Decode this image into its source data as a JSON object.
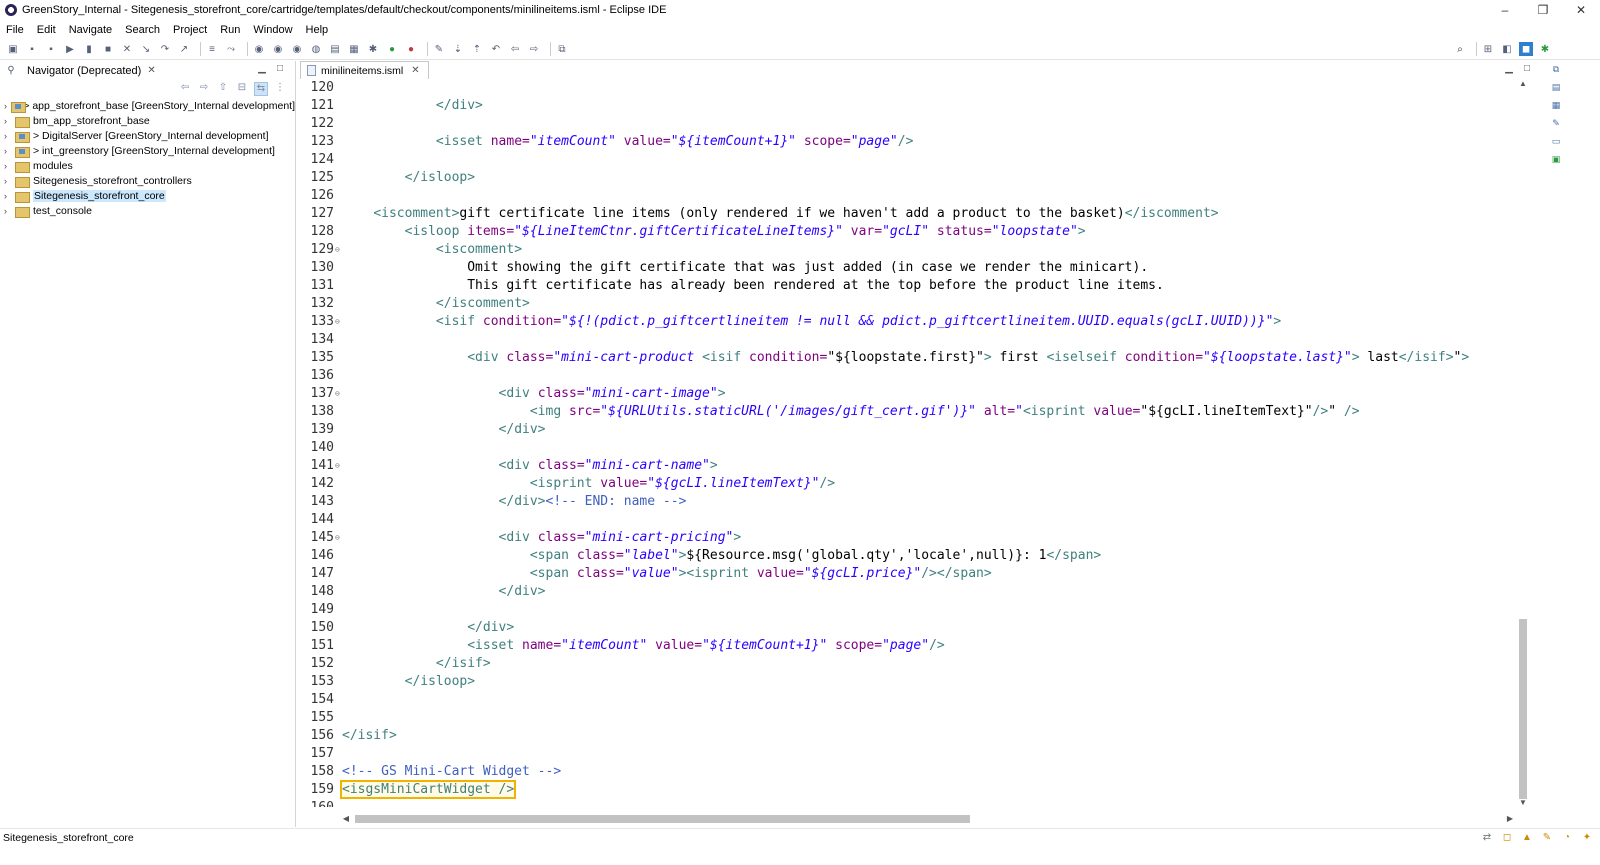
{
  "window": {
    "title": "GreenStory_Internal - Sitegenesis_storefront_core/cartridge/templates/default/checkout/components/minilineitems.isml - Eclipse IDE",
    "minimize": "–",
    "restore": "❐",
    "close": "✕"
  },
  "menu": [
    "File",
    "Edit",
    "Navigate",
    "Search",
    "Project",
    "Run",
    "Window",
    "Help"
  ],
  "navigator": {
    "tab_label": "Navigator (Deprecated)",
    "close": "✕",
    "items": [
      {
        "label": "> app_storefront_base [GreenStory_Internal development]",
        "project": true,
        "selected": false
      },
      {
        "label": "bm_app_storefront_base",
        "project": false,
        "selected": false
      },
      {
        "label": "> DigitalServer [GreenStory_Internal development]",
        "project": true,
        "selected": false
      },
      {
        "label": "> int_greenstory [GreenStory_Internal development]",
        "project": true,
        "selected": false
      },
      {
        "label": "modules",
        "project": false,
        "selected": false
      },
      {
        "label": "Sitegenesis_storefront_controllers",
        "project": false,
        "selected": false
      },
      {
        "label": "Sitegenesis_storefront_core",
        "project": false,
        "selected": true
      },
      {
        "label": "test_console",
        "project": false,
        "selected": false
      }
    ]
  },
  "editor": {
    "tab_label": "minilineitems.isml",
    "close": "✕",
    "lines": [
      {
        "n": "120",
        "html": ""
      },
      {
        "n": "121",
        "html": "            <span class=\"t\">&lt;/div&gt;</span>"
      },
      {
        "n": "122",
        "html": ""
      },
      {
        "n": "123",
        "html": "            <span class=\"t\">&lt;isset</span> <span class=\"a\">name=</span><span class=\"v\">\"itemCount\"</span> <span class=\"a\">value=</span><span class=\"v\">\"${itemCount+1}\"</span> <span class=\"a\">scope=</span><span class=\"v\">\"page\"</span><span class=\"t\">/&gt;</span>"
      },
      {
        "n": "124",
        "html": ""
      },
      {
        "n": "125",
        "html": "        <span class=\"t\">&lt;/isloop&gt;</span>"
      },
      {
        "n": "126",
        "html": ""
      },
      {
        "n": "127",
        "html": "    <span class=\"t\">&lt;iscomment&gt;</span>gift certificate line items (only rendered if we haven't add a product to the basket)<span class=\"t\">&lt;/iscomment&gt;</span>"
      },
      {
        "n": "128",
        "html": "        <span class=\"t\">&lt;isloop</span> <span class=\"a\">items=</span><span class=\"v\">\"${LineItemCtnr.giftCertificateLineItems}\"</span> <span class=\"a\">var=</span><span class=\"v\">\"gcLI\"</span> <span class=\"a\">status=</span><span class=\"v\">\"loopstate\"</span><span class=\"t\">&gt;</span>"
      },
      {
        "n": "129",
        "fold": true,
        "html": "            <span class=\"t\">&lt;iscomment&gt;</span>"
      },
      {
        "n": "130",
        "html": "                Omit showing the gift certificate that was just added (in case we render the minicart)."
      },
      {
        "n": "131",
        "html": "                This gift certificate has already been rendered at the top before the product line items."
      },
      {
        "n": "132",
        "html": "            <span class=\"t\">&lt;/iscomment&gt;</span>"
      },
      {
        "n": "133",
        "fold": true,
        "html": "            <span class=\"t\">&lt;isif</span> <span class=\"a\">condition=</span><span class=\"v\">\"${!(pdict.p_giftcertlineitem != null &amp;&amp; pdict.p_giftcertlineitem.UUID.equals(gcLI.UUID))}\"</span><span class=\"t\">&gt;</span>"
      },
      {
        "n": "134",
        "html": ""
      },
      {
        "n": "135",
        "html": "                <span class=\"t\">&lt;div</span> <span class=\"a\">class=</span><span class=\"v\">\"mini-cart-product </span><span class=\"t\">&lt;isif</span> <span class=\"a\">condition=</span>\"${loopstate.first}\"<span class=\"t\">&gt;</span> first <span class=\"t\">&lt;iselseif</span> <span class=\"a\">condition=</span><span class=\"v\">\"${loopstate.last}\"</span><span class=\"t\">&gt;</span> last<span class=\"t\">&lt;/isif&gt;</span>\"<span class=\"t\">&gt;</span>"
      },
      {
        "n": "136",
        "html": ""
      },
      {
        "n": "137",
        "fold": true,
        "html": "                    <span class=\"t\">&lt;div</span> <span class=\"a\">class=</span><span class=\"v\">\"mini-cart-image\"</span><span class=\"t\">&gt;</span>"
      },
      {
        "n": "138",
        "html": "                        <span class=\"t\">&lt;img</span> <span class=\"a\">src=</span><span class=\"v\">\"${URLUtils.staticURL('/images/gift_cert.gif')}\"</span> <span class=\"a\">alt=</span><span class=\"v\">\"</span><span class=\"t\">&lt;isprint</span> <span class=\"a\">value=</span>\"${gcLI.lineItemText}\"<span class=\"t\">/&gt;</span>\" <span class=\"t\">/&gt;</span>"
      },
      {
        "n": "139",
        "html": "                    <span class=\"t\">&lt;/div&gt;</span>"
      },
      {
        "n": "140",
        "html": ""
      },
      {
        "n": "141",
        "fold": true,
        "html": "                    <span class=\"t\">&lt;div</span> <span class=\"a\">class=</span><span class=\"v\">\"mini-cart-name\"</span><span class=\"t\">&gt;</span>"
      },
      {
        "n": "142",
        "html": "                        <span class=\"t\">&lt;isprint</span> <span class=\"a\">value=</span><span class=\"v\">\"${gcLI.lineItemText}\"</span><span class=\"t\">/&gt;</span>"
      },
      {
        "n": "143",
        "html": "                    <span class=\"t\">&lt;/div&gt;</span><span class=\"c\">&lt;!-- END: name --&gt;</span>"
      },
      {
        "n": "144",
        "html": ""
      },
      {
        "n": "145",
        "fold": true,
        "html": "                    <span class=\"t\">&lt;div</span> <span class=\"a\">class=</span><span class=\"v\">\"mini-cart-pricing\"</span><span class=\"t\">&gt;</span>"
      },
      {
        "n": "146",
        "html": "                        <span class=\"t\">&lt;span</span> <span class=\"a\">class=</span><span class=\"v\">\"label\"</span><span class=\"t\">&gt;</span>${Resource.msg('global.qty','locale',null)}: 1<span class=\"t\">&lt;/span&gt;</span>"
      },
      {
        "n": "147",
        "html": "                        <span class=\"t\">&lt;span</span> <span class=\"a\">class=</span><span class=\"v\">\"value\"</span><span class=\"t\">&gt;&lt;isprint</span> <span class=\"a\">value=</span><span class=\"v\">\"${gcLI.price}\"</span><span class=\"t\">/&gt;&lt;/span&gt;</span>"
      },
      {
        "n": "148",
        "html": "                    <span class=\"t\">&lt;/div&gt;</span>"
      },
      {
        "n": "149",
        "html": ""
      },
      {
        "n": "150",
        "html": "                <span class=\"t\">&lt;/div&gt;</span>"
      },
      {
        "n": "151",
        "html": "                <span class=\"t\">&lt;isset</span> <span class=\"a\">name=</span><span class=\"v\">\"itemCount\"</span> <span class=\"a\">value=</span><span class=\"v\">\"${itemCount+1}\"</span> <span class=\"a\">scope=</span><span class=\"v\">\"page\"</span><span class=\"t\">/&gt;</span>"
      },
      {
        "n": "152",
        "html": "            <span class=\"t\">&lt;/isif&gt;</span>"
      },
      {
        "n": "153",
        "html": "        <span class=\"t\">&lt;/isloop&gt;</span>"
      },
      {
        "n": "154",
        "html": ""
      },
      {
        "n": "155",
        "html": ""
      },
      {
        "n": "156",
        "html": "<span class=\"t\">&lt;/isif&gt;</span>"
      },
      {
        "n": "157",
        "html": ""
      },
      {
        "n": "158",
        "html": "<span class=\"c\">&lt;!-- GS Mini-Cart Widget --&gt;</span>"
      },
      {
        "n": "159",
        "html": "<span class=\"hl\"><span class=\"t\">&lt;isgsMiniCartWidget /&gt;</span></span>"
      },
      {
        "n": "160",
        "html": ""
      }
    ]
  },
  "status_bar": {
    "text": "Sitegenesis_storefront_core"
  },
  "colors": {
    "tag": "#3f7f7f",
    "attribute": "#7f007f",
    "value": "#2a00ff",
    "comment": "#3f5fbf",
    "highlight": "#f0b400"
  }
}
